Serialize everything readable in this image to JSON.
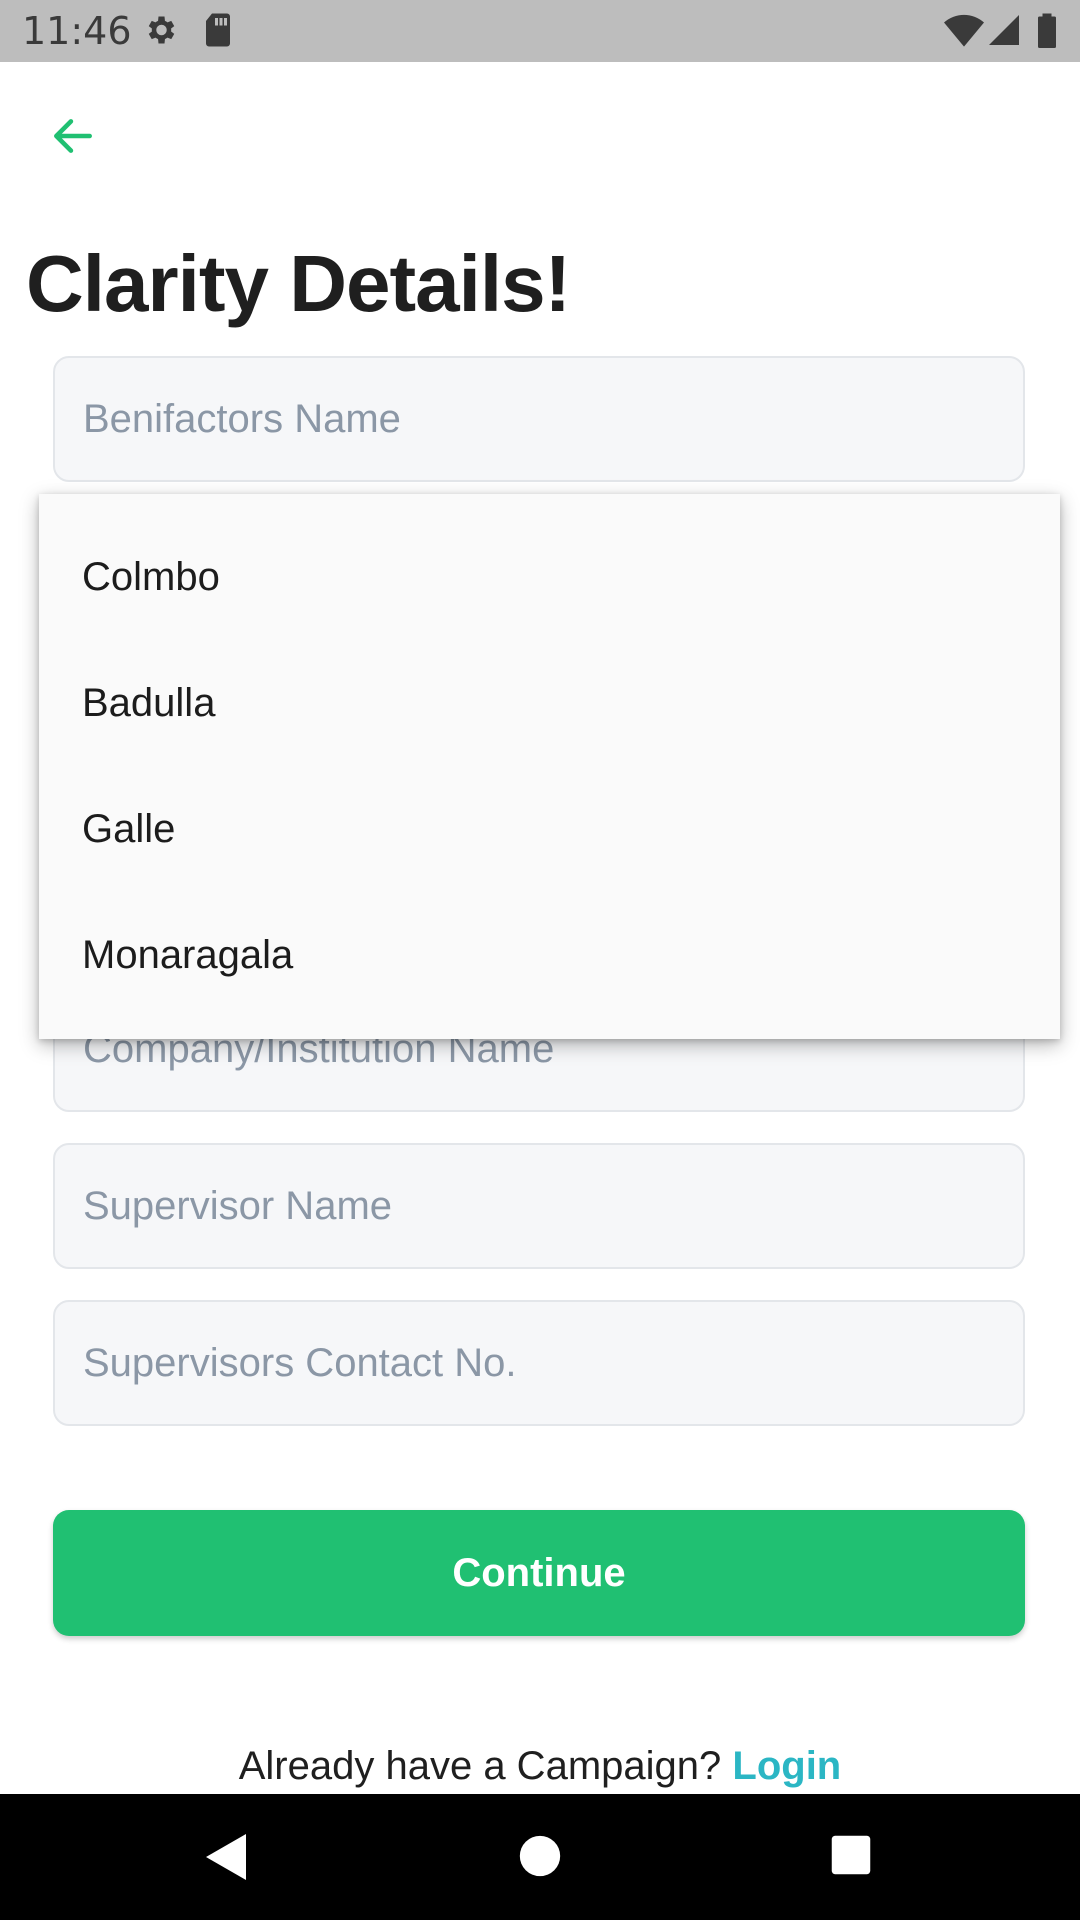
{
  "status_bar": {
    "time": "11:46",
    "icons": [
      "gear-icon",
      "sd-card-icon",
      "wifi-icon",
      "signal-icon",
      "battery-icon"
    ]
  },
  "header": {
    "back_icon": "arrow-left-icon",
    "title": "Clarity Details!"
  },
  "form": {
    "fields": [
      {
        "placeholder": "Benifactors Name"
      },
      {
        "placeholder": "Company/Institution Name"
      },
      {
        "placeholder": "Supervisor Name"
      },
      {
        "placeholder": "Supervisors Contact No."
      }
    ],
    "dropdown_options": [
      "Colmbo",
      "Badulla",
      "Galle",
      "Monaragala"
    ],
    "continue_label": "Continue"
  },
  "footer": {
    "prompt": "Already have a Campaign?",
    "login_label": "Login"
  },
  "nav_bar": {
    "icons": [
      "back-triangle-icon",
      "home-circle-icon",
      "recents-square-icon"
    ]
  },
  "colors": {
    "accent": "#20C072",
    "link": "#2BB6C4",
    "status_bar": "#BDBDBD"
  }
}
